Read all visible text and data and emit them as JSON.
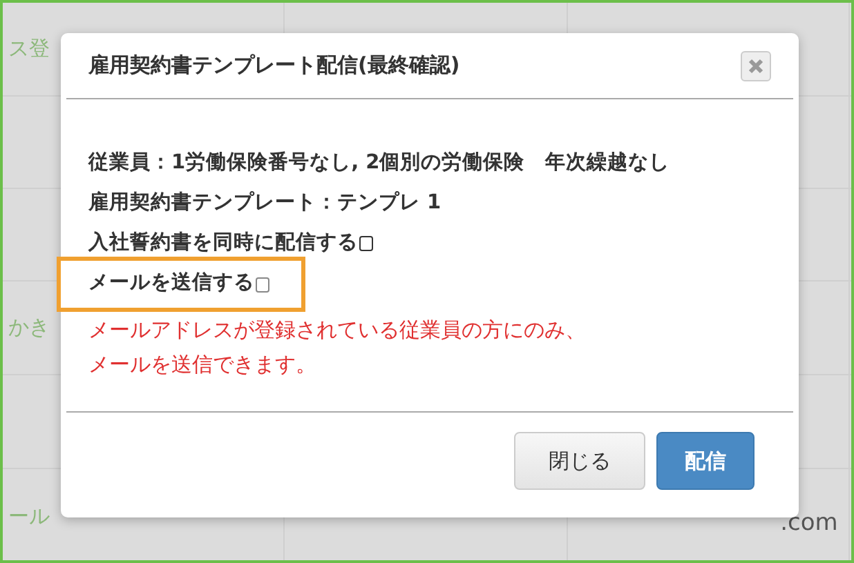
{
  "background_table": {
    "rows": [
      {
        "column_1": "ス登"
      },
      {},
      {},
      {
        "column_1": "かき"
      },
      {},
      {
        "column_1": "ール",
        "column_3": ".com"
      }
    ]
  },
  "dialog": {
    "title": "雇用契約書テンプレート配信(最終確認)",
    "lines": [
      {
        "kind": "text",
        "text": "従業員：1労働保険番号なし, 2個別の労働保険　年次繰越なし"
      },
      {
        "kind": "text",
        "text": "雇用契約書テンプレート：テンプレ 1"
      },
      {
        "kind": "checkbox",
        "text": "入社誓約書を同時に配信する",
        "checked": false,
        "highlighted": false
      },
      {
        "kind": "checkbox",
        "text": "メールを送信する",
        "checked": false,
        "highlighted": true
      }
    ],
    "notice_lines": [
      "メールアドレスが登録されている従業員の方にのみ、",
      "メールを送信できます。"
    ],
    "buttons": [
      {
        "label": "閉じる",
        "kind": "secondary"
      },
      {
        "label": "配信",
        "kind": "primary"
      }
    ]
  }
}
